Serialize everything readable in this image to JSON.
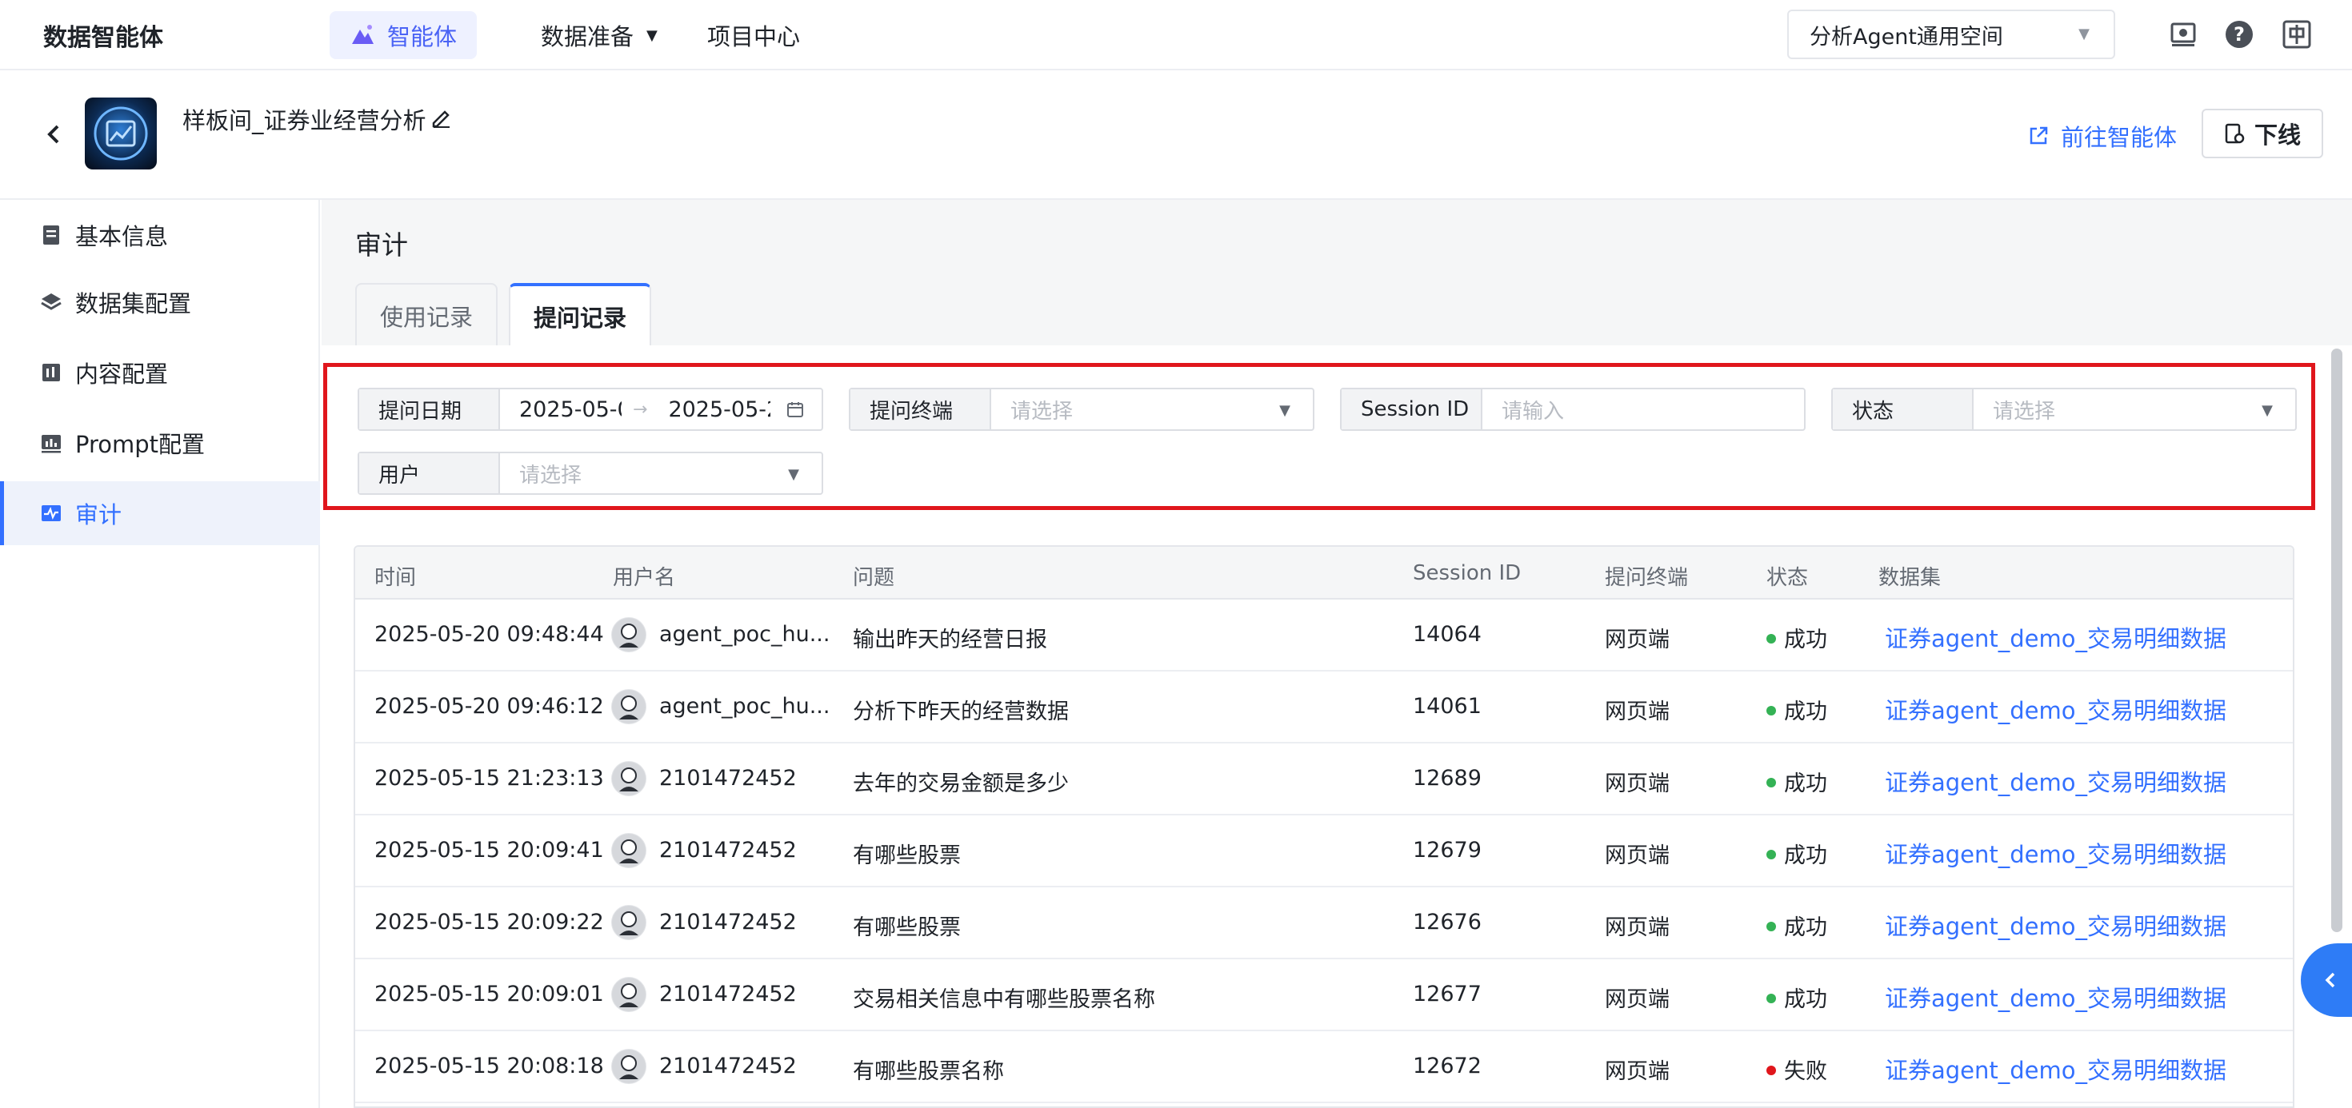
{
  "topbar": {
    "brand": "数据智能体",
    "nav": [
      {
        "label": "智能体",
        "active": true
      },
      {
        "label": "数据准备",
        "has_dropdown": true
      },
      {
        "label": "项目中心"
      }
    ],
    "space_select": "分析Agent通用空间",
    "icons": [
      "screen-icon",
      "help-icon",
      "language-icon"
    ]
  },
  "header": {
    "title": "样板间_证券业经营分析",
    "goto_label": "前往智能体",
    "offline_label": "下线"
  },
  "sidebar": {
    "items": [
      {
        "label": "基本信息",
        "icon": "document-icon"
      },
      {
        "label": "数据集配置",
        "icon": "layers-icon"
      },
      {
        "label": "内容配置",
        "icon": "content-icon"
      },
      {
        "label": "Prompt配置",
        "icon": "chart-icon"
      },
      {
        "label": "审计",
        "icon": "audit-icon",
        "active": true
      }
    ]
  },
  "main": {
    "section_title": "审计",
    "tabs": [
      {
        "label": "使用记录",
        "active": false
      },
      {
        "label": "提问记录",
        "active": true
      }
    ],
    "filters": {
      "date": {
        "label": "提问日期",
        "start": "2025-05-0",
        "end": "2025-05-2"
      },
      "terminal": {
        "label": "提问终端",
        "placeholder": "请选择"
      },
      "session": {
        "label": "Session ID",
        "placeholder": "请输入"
      },
      "status": {
        "label": "状态",
        "placeholder": "请选择"
      },
      "user": {
        "label": "用户",
        "placeholder": "请选择"
      }
    },
    "table": {
      "columns": [
        "时间",
        "用户名",
        "问题",
        "Session ID",
        "提问终端",
        "状态",
        "数据集"
      ],
      "rows": [
        {
          "time": "2025-05-20 09:48:44",
          "user": "agent_poc_hu...",
          "question": "输出昨天的经营日报",
          "session": "14064",
          "terminal": "网页端",
          "status": "成功",
          "dataset": "证券agent_demo_交易明细数据"
        },
        {
          "time": "2025-05-20 09:46:12",
          "user": "agent_poc_hu...",
          "question": "分析下昨天的经营数据",
          "session": "14061",
          "terminal": "网页端",
          "status": "成功",
          "dataset": "证券agent_demo_交易明细数据"
        },
        {
          "time": "2025-05-15 21:23:13",
          "user": "2101472452",
          "question": "去年的交易金额是多少",
          "session": "12689",
          "terminal": "网页端",
          "status": "成功",
          "dataset": "证券agent_demo_交易明细数据"
        },
        {
          "time": "2025-05-15 20:09:41",
          "user": "2101472452",
          "question": "有哪些股票",
          "session": "12679",
          "terminal": "网页端",
          "status": "成功",
          "dataset": "证券agent_demo_交易明细数据"
        },
        {
          "time": "2025-05-15 20:09:22",
          "user": "2101472452",
          "question": "有哪些股票",
          "session": "12676",
          "terminal": "网页端",
          "status": "成功",
          "dataset": "证券agent_demo_交易明细数据"
        },
        {
          "time": "2025-05-15 20:09:01",
          "user": "2101472452",
          "question": "交易相关信息中有哪些股票名称",
          "session": "12677",
          "terminal": "网页端",
          "status": "成功",
          "dataset": "证券agent_demo_交易明细数据"
        },
        {
          "time": "2025-05-15 20:08:18",
          "user": "2101472452",
          "question": "有哪些股票名称",
          "session": "12672",
          "terminal": "网页端",
          "status": "失败",
          "dataset": "证券agent_demo_交易明细数据"
        }
      ]
    }
  },
  "colors": {
    "accent": "#3370ff",
    "success": "#34b255",
    "fail": "#e0161c",
    "highlight_border": "#e0161c"
  }
}
